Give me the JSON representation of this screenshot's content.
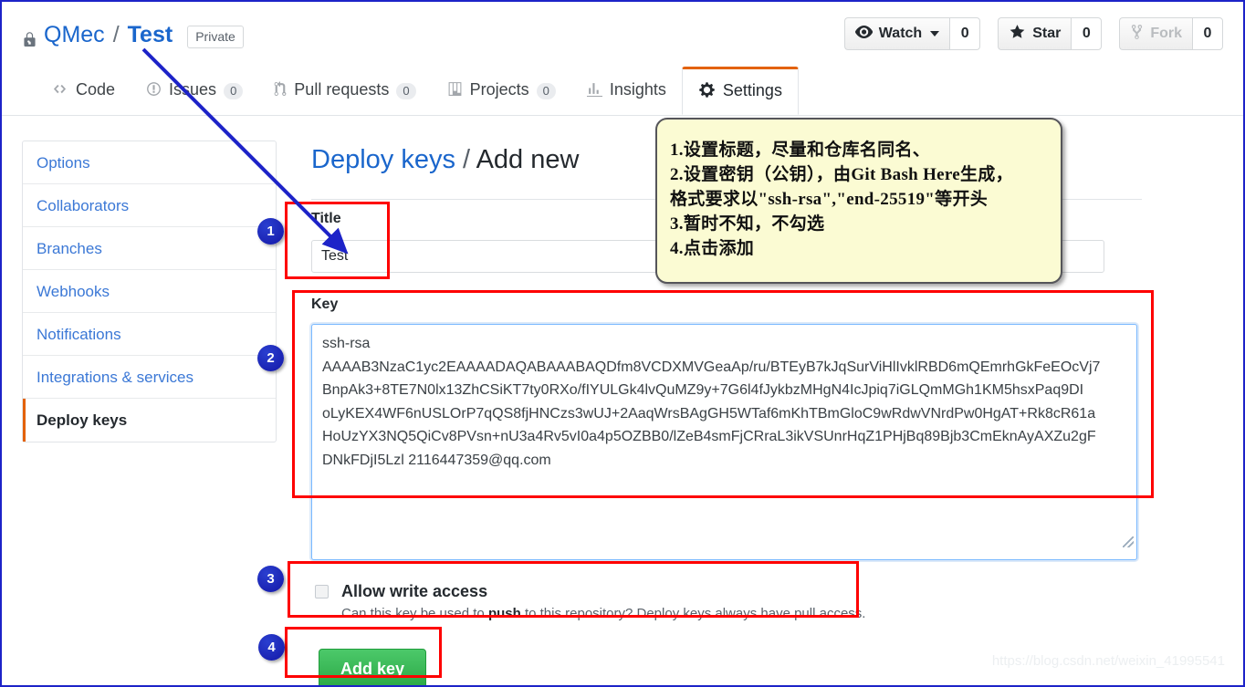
{
  "repo": {
    "lock_icon": "lock-icon",
    "owner": "QMec",
    "separator": "/",
    "name": "Test",
    "visibility": "Private"
  },
  "actions": [
    {
      "icon": "eye-icon",
      "label": "Watch",
      "count": "0",
      "has_caret": true,
      "disabled": false
    },
    {
      "icon": "star-icon",
      "label": "Star",
      "count": "0",
      "has_caret": false,
      "disabled": false
    },
    {
      "icon": "fork-icon",
      "label": "Fork",
      "count": "0",
      "has_caret": false,
      "disabled": true
    }
  ],
  "tabs": [
    {
      "icon": "code-icon",
      "label": "Code",
      "count": null,
      "active": false
    },
    {
      "icon": "issue-opened-icon",
      "label": "Issues",
      "count": "0",
      "active": false
    },
    {
      "icon": "git-pull-request-icon",
      "label": "Pull requests",
      "count": "0",
      "active": false
    },
    {
      "icon": "project-board-icon",
      "label": "Projects",
      "count": "0",
      "active": false
    },
    {
      "icon": "graph-icon",
      "label": "Insights",
      "count": null,
      "active": false
    },
    {
      "icon": "gear-icon",
      "label": "Settings",
      "count": null,
      "active": true
    }
  ],
  "sidebar": {
    "items": [
      {
        "label": "Options",
        "selected": false
      },
      {
        "label": "Collaborators",
        "selected": false
      },
      {
        "label": "Branches",
        "selected": false
      },
      {
        "label": "Webhooks",
        "selected": false
      },
      {
        "label": "Notifications",
        "selected": false
      },
      {
        "label": "Integrations & services",
        "selected": false
      },
      {
        "label": "Deploy keys",
        "selected": true
      }
    ]
  },
  "main": {
    "heading_link": "Deploy keys",
    "heading_sep": "/",
    "heading_rest": "Add new",
    "title_label": "Title",
    "title_value": "Test",
    "title_placeholder": "",
    "key_label": "Key",
    "key_value": "ssh-rsa\nAAAAB3NzaC1yc2EAAAADAQABAAABAQDfm8VCDXMVGeaAp/ru/BTEyB7kJqSurViHlIvklRBD6mQEmrhGkFeEOcVj7\nBnpAk3+8TE7N0lx13ZhCSiKT7ty0RXo/fIYULGk4lvQuMZ9y+7G6l4fJykbzMHgN4IcJpiq7iGLQmMGh1KM5hsxPaq9DI\noLyKEX4WF6nUSLOrP7qQS8fjHNCzs3wUJ+2AaqWrsBAgGH5WTaf6mKhTBmGloC9wRdwVNrdPw0HgAT+Rk8cR61a\nHoUzYX3NQ5QiCv8PVsn+nU3a4Rv5vI0a4p5OZBB0/lZeB4smFjCRraL3ikVSUnrHqZ1PHjBq89Bjb3CmEknAyAXZu2gF\nDNkFDjI5Lzl 2116447359@qq.com\n",
    "key_placeholder": "",
    "allow_write_label": "Allow write access",
    "allow_write_checked": false,
    "allow_write_help_prefix": "Can this key be used to ",
    "allow_write_help_strong": "push",
    "allow_write_help_suffix": " to this repository? Deploy keys always have pull access.",
    "add_key_label": "Add key"
  },
  "annotation": {
    "note_text": "1.设置标题，尽量和仓库名同名、\n2.设置密钥（公钥），由Git Bash Here生成，\n格式要求以\"ssh-rsa\",\"end-25519\"等开头\n3.暂时不知，不勾选\n4.点击添加",
    "badges": [
      "1",
      "2",
      "3",
      "4"
    ],
    "highlight_color": "#fe0000",
    "arrow_color": "#1d23c8",
    "badge_color": "#1417a6"
  },
  "watermark": "https://blog.csdn.net/weixin_41995541"
}
